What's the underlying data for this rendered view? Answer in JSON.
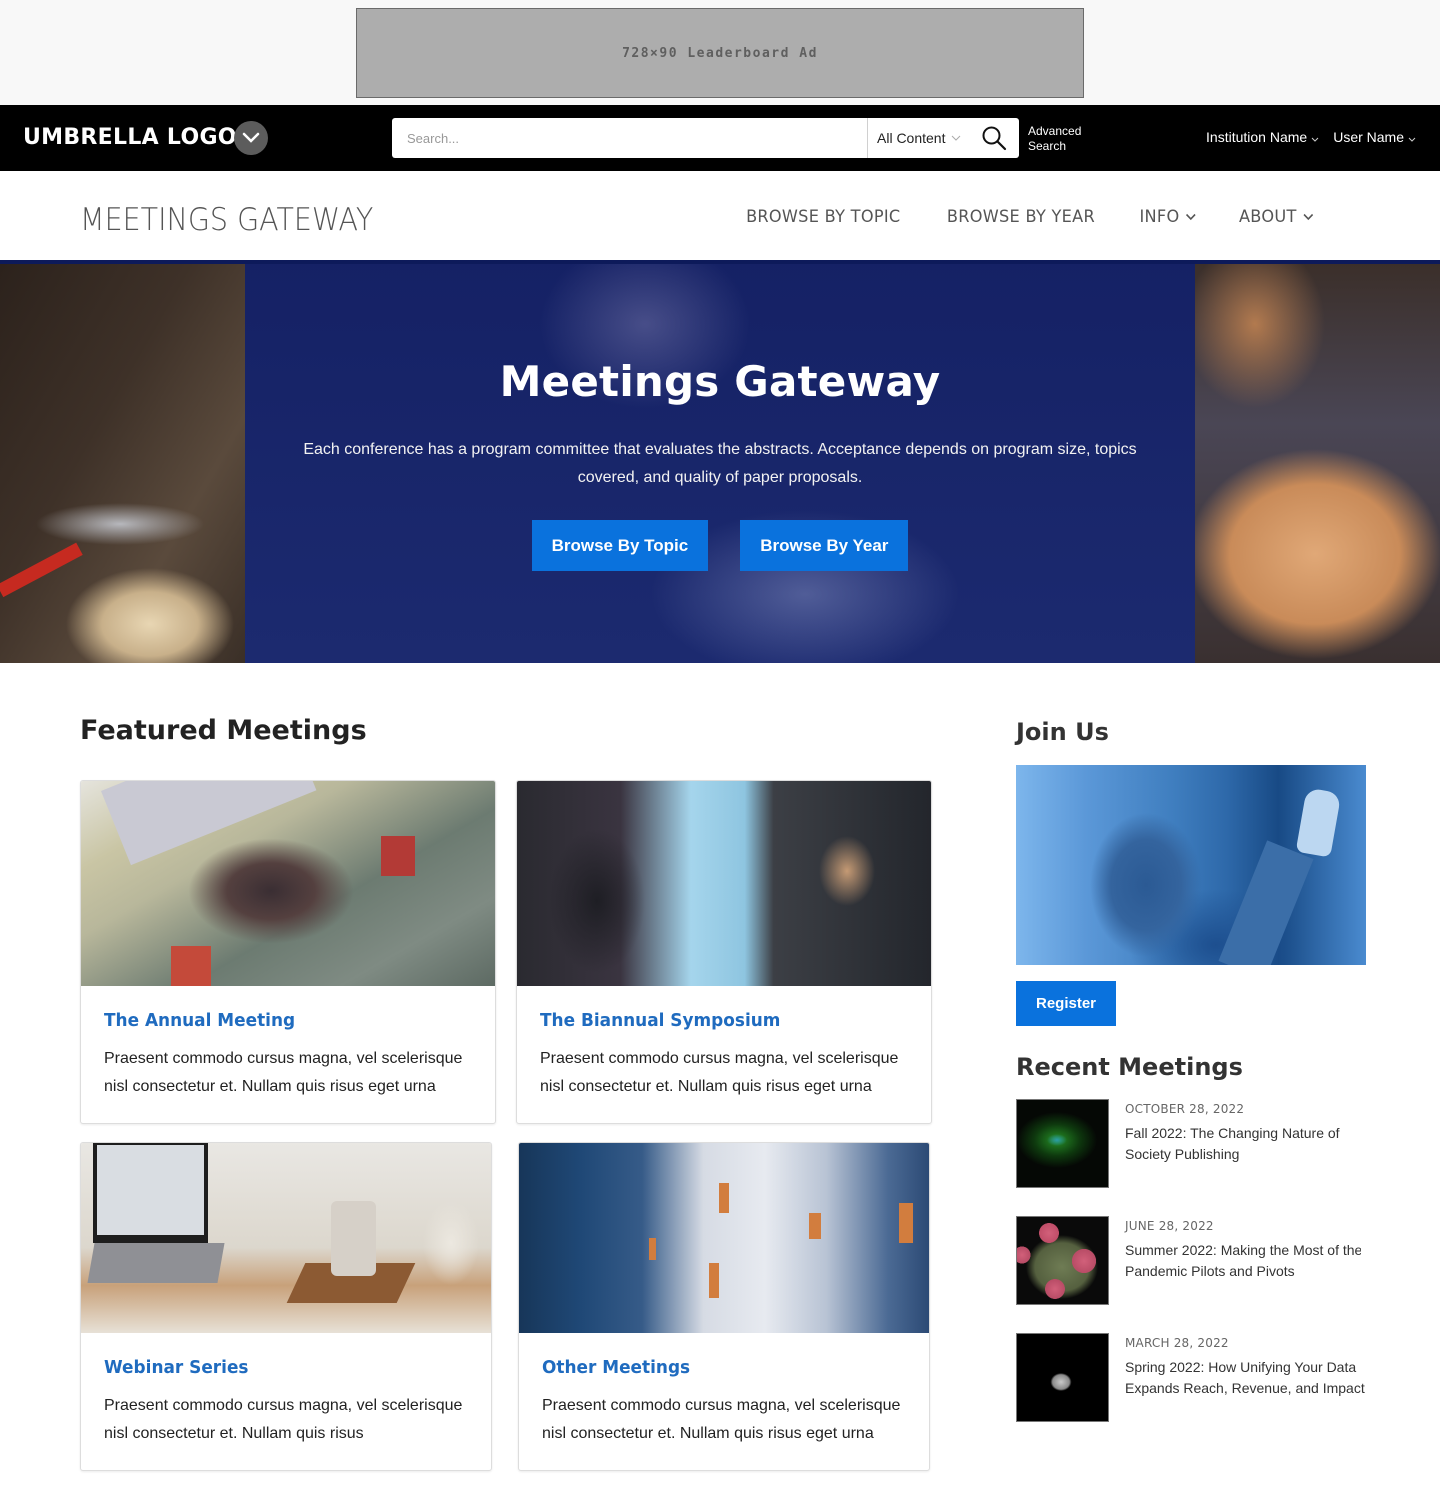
{
  "ad": {
    "label": "728×90 Leaderboard Ad"
  },
  "umbrella": {
    "logo": "UMBRELLA LOGO",
    "toggle_icon": "chevron-down-icon",
    "search": {
      "placeholder": "Search...",
      "value": "",
      "scope": "All Content",
      "submit_icon": "search-icon"
    },
    "advanced_search": [
      "Advanced",
      "Search"
    ],
    "institution": "Institution Name",
    "user": "User Name"
  },
  "site": {
    "title": "MEETINGS GATEWAY",
    "nav": [
      {
        "label": "BROWSE BY TOPIC",
        "dropdown": false
      },
      {
        "label": "BROWSE BY YEAR",
        "dropdown": false
      },
      {
        "label": "INFO",
        "dropdown": true
      },
      {
        "label": "ABOUT",
        "dropdown": true
      }
    ],
    "accent_color": "#0a72dd",
    "link_color": "#1f6bbf",
    "header_rule_color": "#0d1a5a"
  },
  "hero": {
    "title": "Meetings Gateway",
    "description": "Each conference has a program committee that evaluates the abstracts. Acceptance depends on program size, topics covered, and quality of paper proposals.",
    "buttons": [
      "Browse By Topic",
      "Browse By Year"
    ]
  },
  "featured": {
    "title": "Featured Meetings",
    "cards": [
      {
        "title": "The Annual Meeting",
        "text": "Praesent commodo cursus magna, vel scelerisque nisl consectetur et. Nullam quis risus eget urna",
        "image": "conference-hall-photo"
      },
      {
        "title": "The Biannual Symposium",
        "text": "Praesent commodo cursus magna, vel scelerisque nisl consectetur et. Nullam quis risus eget urna",
        "image": "panel-speakers-photo"
      },
      {
        "title": "Webinar Series",
        "text": "Praesent commodo cursus magna, vel scelerisque nisl consectetur et. Nullam quis risus",
        "image": "laptop-desk-photo"
      },
      {
        "title": "Other Meetings",
        "text": "Praesent commodo cursus magna, vel scelerisque nisl consectetur et. Nullam quis risus eget urna",
        "image": "library-shelves-photo"
      }
    ]
  },
  "sidebar": {
    "join_title": "Join Us",
    "register_label": "Register",
    "recent_title": "Recent Meetings",
    "recent": [
      {
        "date": "OCTOBER 28, 2022",
        "title_lines": [
          "Fall 2022: The Changing Nature of",
          "Society Publishing"
        ],
        "thumb": "cells-microscopy"
      },
      {
        "date": "JUNE 28, 2022",
        "title_lines": [
          "Summer 2022: Making the Most of the",
          "Pandemic Pilots and Pivots"
        ],
        "thumb": "virus-microscopy"
      },
      {
        "date": "MARCH 28, 2022",
        "title_lines": [
          "Spring 2022: How Unifying Your Data",
          "Expands Reach, Revenue, and Impact"
        ],
        "thumb": "moon"
      }
    ]
  }
}
